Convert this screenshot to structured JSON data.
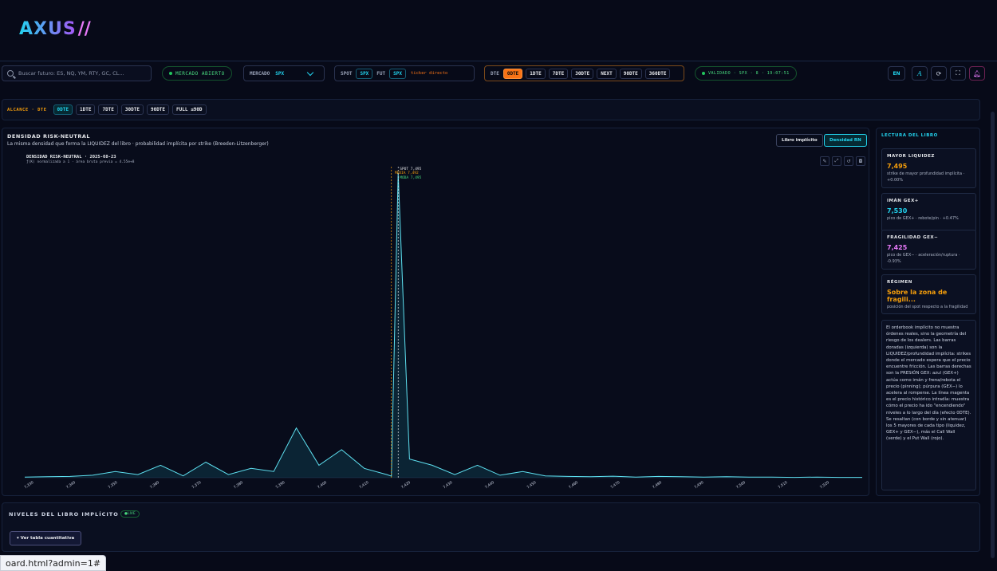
{
  "brand": {
    "logo": "AXUS"
  },
  "topbar": {
    "search_placeholder": "Buscar futuro: ES, NQ, YM, RTY, GC, CL...",
    "market_status": "MERCADO ABIERTO",
    "mercado_label": "MERCADO",
    "mercado_value": "SPX",
    "spot_label": "SPOT",
    "spot_value": "SPX",
    "fut_label": "FUT",
    "fut_value": "SPX",
    "ticker_note": "ticker directo",
    "dte_label": "DTE",
    "dte_options": [
      "0DTE",
      "1DTE",
      "7DTE",
      "30DTE",
      "NEXT",
      "90DTE",
      "360DTE"
    ],
    "dte_active": "0DTE",
    "validated": "VALIDADO · SPX · 8 · 19:07:51",
    "lang": "EN",
    "font_icon": "A",
    "icons": [
      "refresh-icon",
      "fullscreen-icon",
      "bell-icon"
    ]
  },
  "alcance": {
    "label": "ALCANCE · DTE",
    "options": [
      "0DTE",
      "1DTE",
      "7DTE",
      "30DTE",
      "90DTE",
      "FULL ≤90D"
    ],
    "active": "0DTE"
  },
  "chart": {
    "title": "DENSIDAD RISK-NEUTRAL",
    "subtitle": "La misma densidad que forma la LIQUIDEZ del libro · probabilidad implícita por strike (Breeden-Litzenberger)",
    "btn_libro": "Libro implícito",
    "btn_densidad": "Densidad RN",
    "plot_title": "DENSIDAD RISK-NEUTRAL · 2025-08-23",
    "plot_sub": "ƒ(K) normalizada a 1 · área bruta previa = 4.55e+8",
    "tools": [
      "pencil-icon",
      "expand-icon",
      "reset-icon",
      "camera-icon"
    ],
    "markers": {
      "media": "MEDIA 7,492",
      "spot": "SPOT 7,495",
      "moda": "MODA 7,495"
    }
  },
  "chart_data": {
    "type": "area",
    "x": [
      7330,
      7340,
      7350,
      7360,
      7370,
      7380,
      7390,
      7400,
      7410,
      7420,
      7430,
      7440,
      7450,
      7460,
      7470,
      7480,
      7490,
      7492,
      7495,
      7500,
      7510,
      7520,
      7530,
      7540,
      7550,
      7560,
      7570,
      7580,
      7590,
      7600,
      7610,
      7620,
      7630,
      7640,
      7650,
      7660,
      7670,
      7680,
      7690,
      7700
    ],
    "y": [
      0.002,
      0.003,
      0.004,
      0.008,
      0.02,
      0.01,
      0.04,
      0.006,
      0.05,
      0.01,
      0.03,
      0.02,
      0.16,
      0.04,
      0.09,
      0.03,
      0.01,
      0.005,
      0.98,
      0.06,
      0.04,
      0.01,
      0.04,
      0.008,
      0.02,
      0.006,
      0.004,
      0.003,
      0.005,
      0.002,
      0.004,
      0.003,
      0.002,
      0.003,
      0.002,
      0.002,
      0.001,
      0.002,
      0.001,
      0.001
    ],
    "x_ticks": [
      "7,330",
      "7,340",
      "7,350",
      "7,360",
      "7,370",
      "7,380",
      "7,390",
      "7,400",
      "7,410",
      "7,420",
      "7,430",
      "7,440",
      "7,450",
      "7,460",
      "7,470",
      "7,480",
      "7,490",
      "7,500",
      "7,510",
      "7,520"
    ],
    "ylim": [
      0,
      1.0
    ],
    "spot": 7495,
    "media": 7492,
    "moda": 7495
  },
  "side": {
    "title": "LECTURA DEL LIBRO",
    "cards": [
      {
        "k": "MAYOR LIQUIDEZ",
        "v": "7,495",
        "color": "#f59e0b",
        "d": "strike de mayor profundidad implícita · +0.00%"
      },
      {
        "k": "IMÁN GEX+",
        "v": "7,530",
        "color": "#22d3ee",
        "d": "pico de GEX+ · rebote/pin · +0.47%"
      },
      {
        "k": "FRAGILIDAD GEX−",
        "v": "7,425",
        "color": "#e879f9",
        "d": "pico de GEX− · aceleración/ruptura · -0.93%"
      },
      {
        "k": "RÉGIMEN",
        "v": "Sobre la zona de fragili...",
        "color": "#f59e0b",
        "d": "posición del spot respecto a la fragilidad"
      }
    ],
    "note": "El orderbook implícito no muestra órdenes reales, sino la geometría del riesgo de los dealers. Las barras doradas (izquierda) son la LIQUIDEZ/profundidad implícita: strikes donde el mercado espera que el precio encuentre fricción. Las barras derechas son la PRESIÓN GEX: azul (GEX+) actúa como imán y frena/rebota el precio (pinning); púrpura (GEX−) lo acelera al romperse. La línea magenta es el precio histórico intradía: muestra cómo el precio ha ido \"encendiendo\" niveles a lo largo del día (efecto 0DTE). Se resaltan (con borde y sin atenuar) los 5 mayores de cada tipo (liquidez, GEX+ y GEX−), más el Call Wall (verde) y el Put Wall (rojo)."
  },
  "niveles": {
    "title": "NIVELES DEL LIBRO IMPLÍCITO",
    "live": "LIVE",
    "btn": "▾ Ver tabla cuantitativa"
  },
  "status_url": "oard.html?admin=1#"
}
